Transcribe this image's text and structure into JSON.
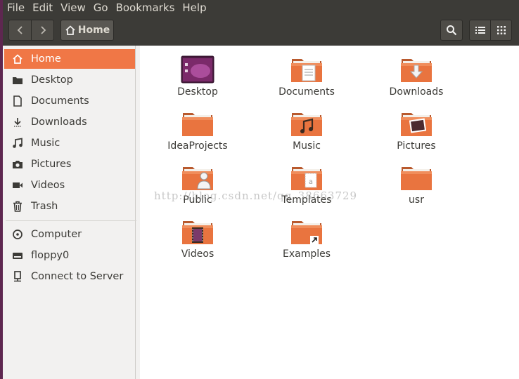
{
  "menubar": {
    "items": [
      "File",
      "Edit",
      "View",
      "Go",
      "Bookmarks",
      "Help"
    ]
  },
  "toolbar": {
    "location_label": "Home"
  },
  "sidebar": {
    "places": [
      {
        "label": "Home",
        "icon": "home-icon",
        "active": true
      },
      {
        "label": "Desktop",
        "icon": "desktop-folder-icon"
      },
      {
        "label": "Documents",
        "icon": "document-icon"
      },
      {
        "label": "Downloads",
        "icon": "download-arrow-icon"
      },
      {
        "label": "Music",
        "icon": "music-note-icon"
      },
      {
        "label": "Pictures",
        "icon": "camera-icon"
      },
      {
        "label": "Videos",
        "icon": "video-icon"
      },
      {
        "label": "Trash",
        "icon": "trash-icon"
      }
    ],
    "devices": [
      {
        "label": "Computer",
        "icon": "hard-disk-icon"
      },
      {
        "label": "floppy0",
        "icon": "floppy-icon"
      },
      {
        "label": "Connect to Server",
        "icon": "network-server-icon"
      }
    ]
  },
  "files": [
    {
      "label": "Desktop",
      "emblem": "desktop"
    },
    {
      "label": "Documents",
      "emblem": "document"
    },
    {
      "label": "Downloads",
      "emblem": "download"
    },
    {
      "label": "IdeaProjects",
      "emblem": "none"
    },
    {
      "label": "Music",
      "emblem": "music"
    },
    {
      "label": "Pictures",
      "emblem": "picture"
    },
    {
      "label": "Public",
      "emblem": "person"
    },
    {
      "label": "Templates",
      "emblem": "template"
    },
    {
      "label": "usr",
      "emblem": "none"
    },
    {
      "label": "Videos",
      "emblem": "video"
    },
    {
      "label": "Examples",
      "emblem": "link"
    }
  ],
  "watermark": "http://blog.csdn.net/qq_38663729",
  "colors": {
    "accent": "#f07746",
    "titlebar": "#3c3b37",
    "folder": "#e9743f"
  }
}
